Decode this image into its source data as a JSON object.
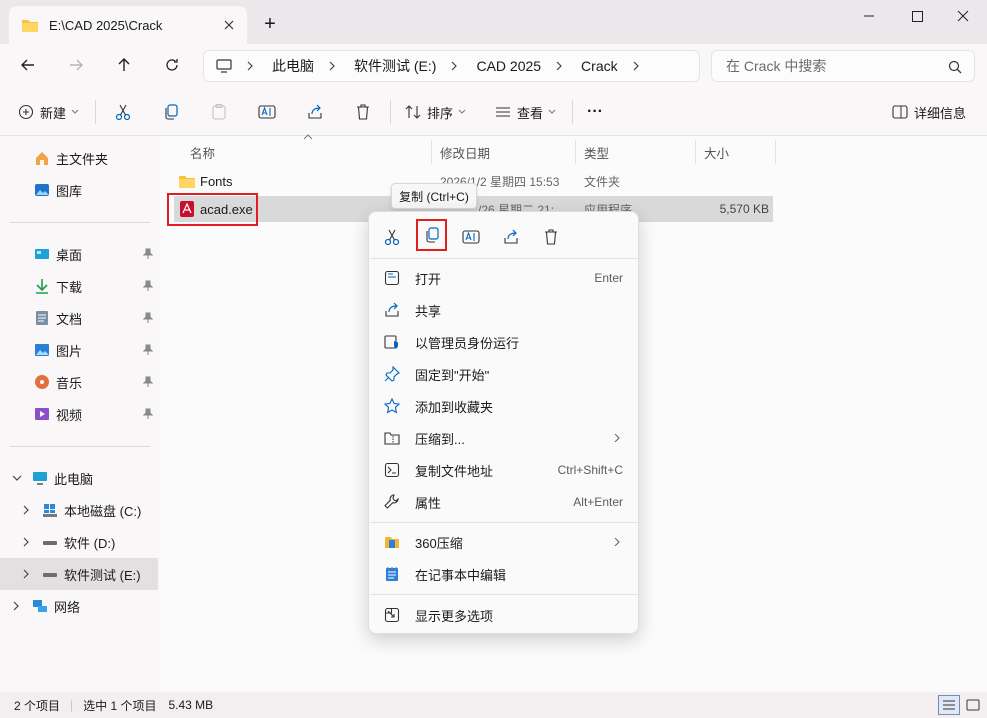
{
  "window": {
    "tab_title": "E:\\CAD 2025\\Crack",
    "new_tab": "+"
  },
  "address": {
    "crumbs": [
      "此电脑",
      "软件测试 (E:)",
      "CAD 2025",
      "Crack"
    ],
    "search_placeholder": "在 Crack 中搜索"
  },
  "toolbar": {
    "new_label": "新建",
    "sort_label": "排序",
    "view_label": "查看",
    "more_label": "···",
    "details_label": "详细信息"
  },
  "sidebar": {
    "quick": [
      {
        "label": "主文件夹",
        "icon": "home-icon"
      },
      {
        "label": "图库",
        "icon": "gallery-icon"
      }
    ],
    "pinned": [
      {
        "label": "桌面",
        "icon": "desktop-icon"
      },
      {
        "label": "下载",
        "icon": "download-icon"
      },
      {
        "label": "文档",
        "icon": "document-icon"
      },
      {
        "label": "图片",
        "icon": "pictures-icon"
      },
      {
        "label": "音乐",
        "icon": "music-icon"
      },
      {
        "label": "视频",
        "icon": "video-icon"
      }
    ],
    "this_pc": "此电脑",
    "drives": [
      {
        "label": "本地磁盘 (C:)"
      },
      {
        "label": "软件 (D:)"
      },
      {
        "label": "软件测试 (E:)"
      }
    ],
    "network": "网络"
  },
  "columns": {
    "name": "名称",
    "modified": "修改日期",
    "type": "类型",
    "size": "大小"
  },
  "files": [
    {
      "name": "Fonts",
      "modified": "2026/1/2 星期四 15:53",
      "type": "文件夹",
      "size": ""
    },
    {
      "name": "acad.exe",
      "modified": "/26 星期二 21:",
      "type": "应用程序",
      "size": "5,570 KB"
    }
  ],
  "tooltip": "复制 (Ctrl+C)",
  "context_menu": {
    "items_a": [
      {
        "label": "打开",
        "shortcut": "Enter",
        "icon": "open-icon"
      },
      {
        "label": "共享",
        "shortcut": "",
        "icon": "share-icon"
      },
      {
        "label": "以管理员身份运行",
        "shortcut": "",
        "icon": "admin-shield-icon"
      },
      {
        "label": "固定到\"开始\"",
        "shortcut": "",
        "icon": "pin-icon"
      },
      {
        "label": "添加到收藏夹",
        "shortcut": "",
        "icon": "star-icon"
      },
      {
        "label": "压缩到...",
        "shortcut": "",
        "icon": "compress-icon"
      },
      {
        "label": "复制文件地址",
        "shortcut": "Ctrl+Shift+C",
        "icon": "copy-path-icon"
      },
      {
        "label": "属性",
        "shortcut": "Alt+Enter",
        "icon": "wrench-icon"
      }
    ],
    "items_b": [
      {
        "label": "360压缩",
        "icon": "zip-360-icon"
      },
      {
        "label": "在记事本中编辑",
        "icon": "notepad-icon"
      }
    ],
    "more": "显示更多选项"
  },
  "status": {
    "count": "2 个项目",
    "selected": "选中 1 个项目",
    "size": "5.43 MB"
  },
  "colors": {
    "accent": "#0067c0",
    "highlight_box": "#e02020",
    "selected_row": "#d9d9d9"
  }
}
